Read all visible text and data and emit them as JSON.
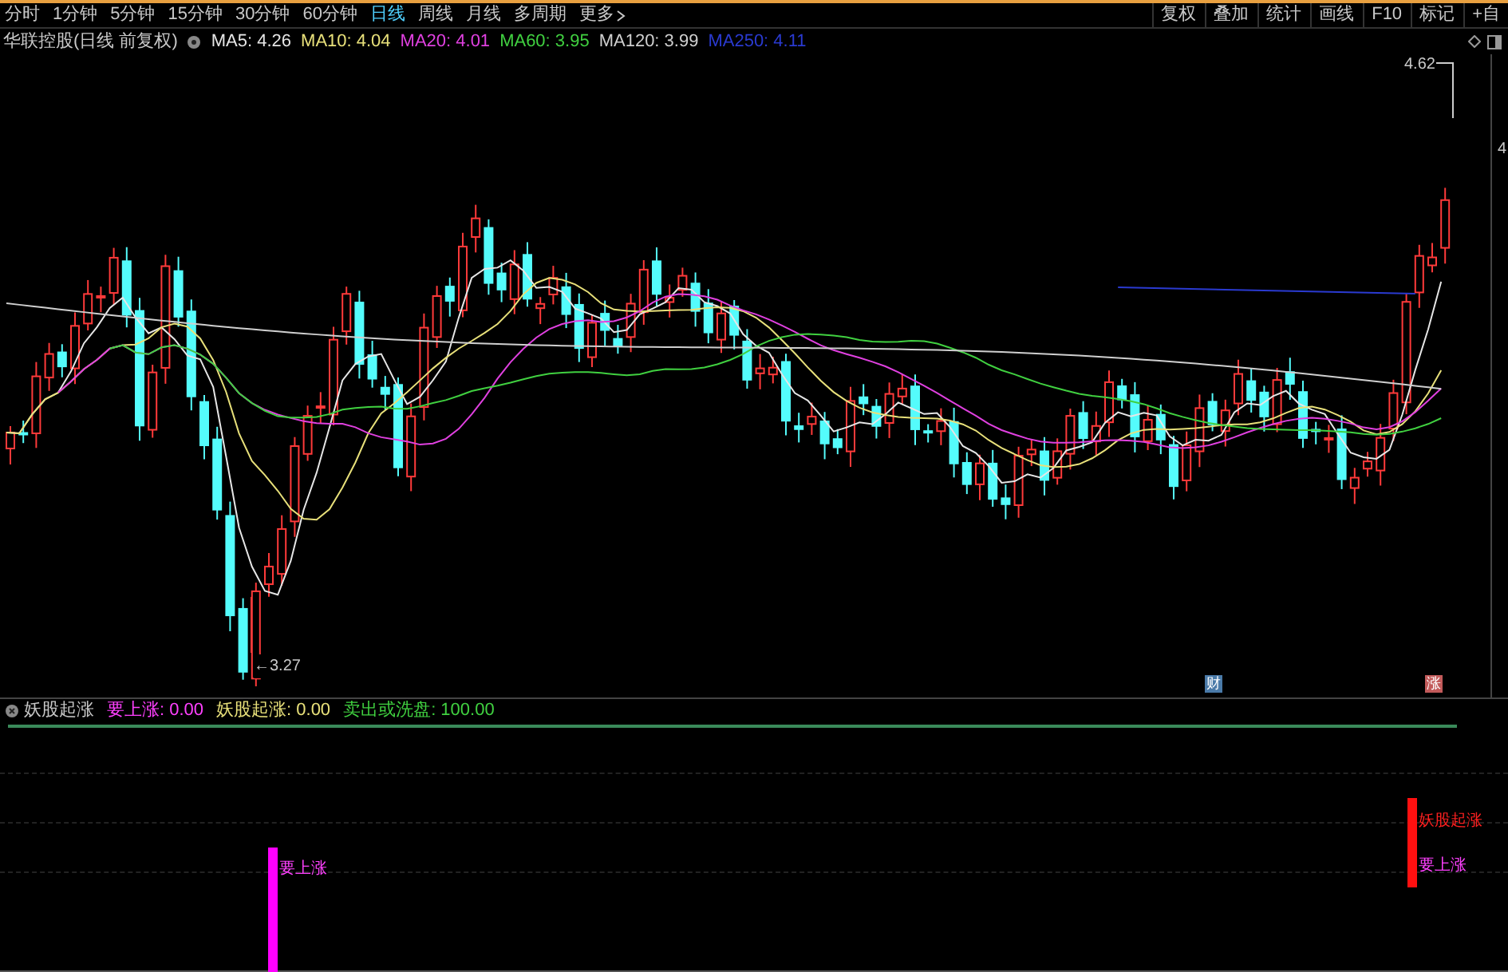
{
  "toolbar": {
    "periods": [
      {
        "label": "分时",
        "selected": false
      },
      {
        "label": "1分钟",
        "selected": false
      },
      {
        "label": "5分钟",
        "selected": false
      },
      {
        "label": "15分钟",
        "selected": false
      },
      {
        "label": "30分钟",
        "selected": false
      },
      {
        "label": "60分钟",
        "selected": false
      },
      {
        "label": "日线",
        "selected": true
      },
      {
        "label": "周线",
        "selected": false
      },
      {
        "label": "月线",
        "selected": false
      },
      {
        "label": "多周期",
        "selected": false
      }
    ],
    "more": "更多",
    "actions": [
      "复权",
      "叠加",
      "统计",
      "画线",
      "F10",
      "标记",
      "+自"
    ]
  },
  "legend": {
    "title": "华联控股(日线 前复权)",
    "mas": [
      {
        "label": "MA5: 4.26",
        "color": "#e6e6e6"
      },
      {
        "label": "MA10: 4.04",
        "color": "#e8e07a"
      },
      {
        "label": "MA20: 4.01",
        "color": "#e040e0"
      },
      {
        "label": "MA60: 3.95",
        "color": "#40d040"
      },
      {
        "label": "MA120: 3.99",
        "color": "#cfcfcf"
      },
      {
        "label": "MA250: 4.11",
        "color": "#2a3ad0"
      }
    ]
  },
  "price_chart": {
    "high_label": "4.62",
    "low_label": "←3.27",
    "axis_label": "4",
    "markers": [
      {
        "text": "财",
        "color": "#4a7aa8"
      },
      {
        "text": "涨",
        "color": "#c25a5a"
      }
    ]
  },
  "indicator": {
    "title": "妖股起涨",
    "values": [
      {
        "label": "要上涨: 0.00",
        "color": "#ff40ff"
      },
      {
        "label": "妖股起涨: 0.00",
        "color": "#e8e07a"
      },
      {
        "label": "卖出或洗盘: 100.00",
        "color": "#40d040"
      }
    ],
    "signals": [
      {
        "color": "#ff00ff",
        "labels": [
          {
            "text": "要上涨",
            "color": "#ff40ff"
          }
        ]
      },
      {
        "color": "#ff1010",
        "labels": [
          {
            "text": "妖股起涨",
            "color": "#ff2020"
          },
          {
            "text": "要上涨",
            "color": "#ff40ff"
          }
        ]
      }
    ]
  }
}
